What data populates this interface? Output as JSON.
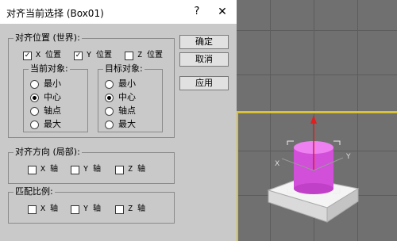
{
  "window": {
    "title": "对齐当前选择 (Box01)",
    "help_label": "?",
    "close_label": "✕"
  },
  "align_position": {
    "label": "对齐位置 (世界):",
    "x": {
      "label": "X 位置",
      "checked": true
    },
    "y": {
      "label": "Y 位置",
      "checked": true
    },
    "z": {
      "label": "Z 位置",
      "checked": false
    }
  },
  "current_object": {
    "label": "当前对象:",
    "options": [
      "最小",
      "中心",
      "轴点",
      "最大"
    ],
    "selected": "中心"
  },
  "target_object": {
    "label": "目标对象:",
    "options": [
      "最小",
      "中心",
      "轴点",
      "最大"
    ],
    "selected": "中心"
  },
  "align_orientation": {
    "label": "对齐方向 (局部):",
    "x": "X 轴",
    "y": "Y 轴",
    "z": "Z 轴"
  },
  "match_scale": {
    "label": "匹配比例:",
    "x": "X 轴",
    "y": "Y 轴",
    "z": "Z 轴"
  },
  "buttons": {
    "ok": "确定",
    "cancel": "取消",
    "apply": "应用"
  },
  "viewport_axes": {
    "x": "X",
    "y": "Y"
  },
  "colors": {
    "cylinder": "#e060e8",
    "box": "#f4f4f4",
    "axis_z": "#e02020",
    "viewport_highlight": "#d8c23a"
  }
}
